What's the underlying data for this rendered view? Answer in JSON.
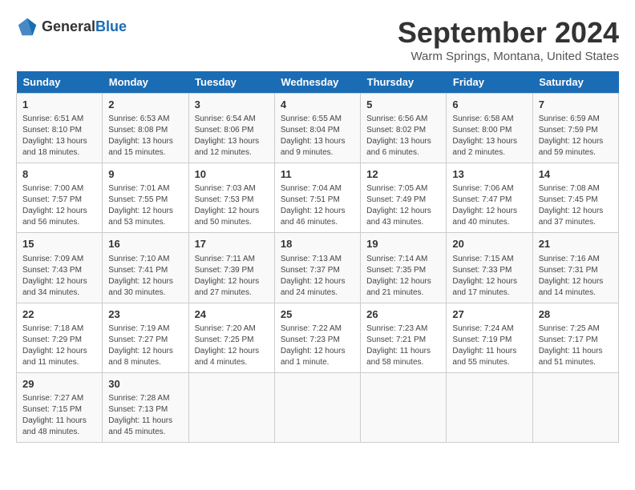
{
  "logo": {
    "general": "General",
    "blue": "Blue"
  },
  "title": "September 2024",
  "location": "Warm Springs, Montana, United States",
  "headers": [
    "Sunday",
    "Monday",
    "Tuesday",
    "Wednesday",
    "Thursday",
    "Friday",
    "Saturday"
  ],
  "rows": [
    [
      {
        "day": "1",
        "sunrise": "6:51 AM",
        "sunset": "8:10 PM",
        "daylight": "13 hours and 18 minutes."
      },
      {
        "day": "2",
        "sunrise": "6:53 AM",
        "sunset": "8:08 PM",
        "daylight": "13 hours and 15 minutes."
      },
      {
        "day": "3",
        "sunrise": "6:54 AM",
        "sunset": "8:06 PM",
        "daylight": "13 hours and 12 minutes."
      },
      {
        "day": "4",
        "sunrise": "6:55 AM",
        "sunset": "8:04 PM",
        "daylight": "13 hours and 9 minutes."
      },
      {
        "day": "5",
        "sunrise": "6:56 AM",
        "sunset": "8:02 PM",
        "daylight": "13 hours and 6 minutes."
      },
      {
        "day": "6",
        "sunrise": "6:58 AM",
        "sunset": "8:00 PM",
        "daylight": "13 hours and 2 minutes."
      },
      {
        "day": "7",
        "sunrise": "6:59 AM",
        "sunset": "7:59 PM",
        "daylight": "12 hours and 59 minutes."
      }
    ],
    [
      {
        "day": "8",
        "sunrise": "7:00 AM",
        "sunset": "7:57 PM",
        "daylight": "12 hours and 56 minutes."
      },
      {
        "day": "9",
        "sunrise": "7:01 AM",
        "sunset": "7:55 PM",
        "daylight": "12 hours and 53 minutes."
      },
      {
        "day": "10",
        "sunrise": "7:03 AM",
        "sunset": "7:53 PM",
        "daylight": "12 hours and 50 minutes."
      },
      {
        "day": "11",
        "sunrise": "7:04 AM",
        "sunset": "7:51 PM",
        "daylight": "12 hours and 46 minutes."
      },
      {
        "day": "12",
        "sunrise": "7:05 AM",
        "sunset": "7:49 PM",
        "daylight": "12 hours and 43 minutes."
      },
      {
        "day": "13",
        "sunrise": "7:06 AM",
        "sunset": "7:47 PM",
        "daylight": "12 hours and 40 minutes."
      },
      {
        "day": "14",
        "sunrise": "7:08 AM",
        "sunset": "7:45 PM",
        "daylight": "12 hours and 37 minutes."
      }
    ],
    [
      {
        "day": "15",
        "sunrise": "7:09 AM",
        "sunset": "7:43 PM",
        "daylight": "12 hours and 34 minutes."
      },
      {
        "day": "16",
        "sunrise": "7:10 AM",
        "sunset": "7:41 PM",
        "daylight": "12 hours and 30 minutes."
      },
      {
        "day": "17",
        "sunrise": "7:11 AM",
        "sunset": "7:39 PM",
        "daylight": "12 hours and 27 minutes."
      },
      {
        "day": "18",
        "sunrise": "7:13 AM",
        "sunset": "7:37 PM",
        "daylight": "12 hours and 24 minutes."
      },
      {
        "day": "19",
        "sunrise": "7:14 AM",
        "sunset": "7:35 PM",
        "daylight": "12 hours and 21 minutes."
      },
      {
        "day": "20",
        "sunrise": "7:15 AM",
        "sunset": "7:33 PM",
        "daylight": "12 hours and 17 minutes."
      },
      {
        "day": "21",
        "sunrise": "7:16 AM",
        "sunset": "7:31 PM",
        "daylight": "12 hours and 14 minutes."
      }
    ],
    [
      {
        "day": "22",
        "sunrise": "7:18 AM",
        "sunset": "7:29 PM",
        "daylight": "12 hours and 11 minutes."
      },
      {
        "day": "23",
        "sunrise": "7:19 AM",
        "sunset": "7:27 PM",
        "daylight": "12 hours and 8 minutes."
      },
      {
        "day": "24",
        "sunrise": "7:20 AM",
        "sunset": "7:25 PM",
        "daylight": "12 hours and 4 minutes."
      },
      {
        "day": "25",
        "sunrise": "7:22 AM",
        "sunset": "7:23 PM",
        "daylight": "12 hours and 1 minute."
      },
      {
        "day": "26",
        "sunrise": "7:23 AM",
        "sunset": "7:21 PM",
        "daylight": "11 hours and 58 minutes."
      },
      {
        "day": "27",
        "sunrise": "7:24 AM",
        "sunset": "7:19 PM",
        "daylight": "11 hours and 55 minutes."
      },
      {
        "day": "28",
        "sunrise": "7:25 AM",
        "sunset": "7:17 PM",
        "daylight": "11 hours and 51 minutes."
      }
    ],
    [
      {
        "day": "29",
        "sunrise": "7:27 AM",
        "sunset": "7:15 PM",
        "daylight": "11 hours and 48 minutes."
      },
      {
        "day": "30",
        "sunrise": "7:28 AM",
        "sunset": "7:13 PM",
        "daylight": "11 hours and 45 minutes."
      },
      null,
      null,
      null,
      null,
      null
    ]
  ],
  "daylight_label": "Daylight hours",
  "sunrise_label": "Sunrise:",
  "sunset_label": "Sunset:"
}
